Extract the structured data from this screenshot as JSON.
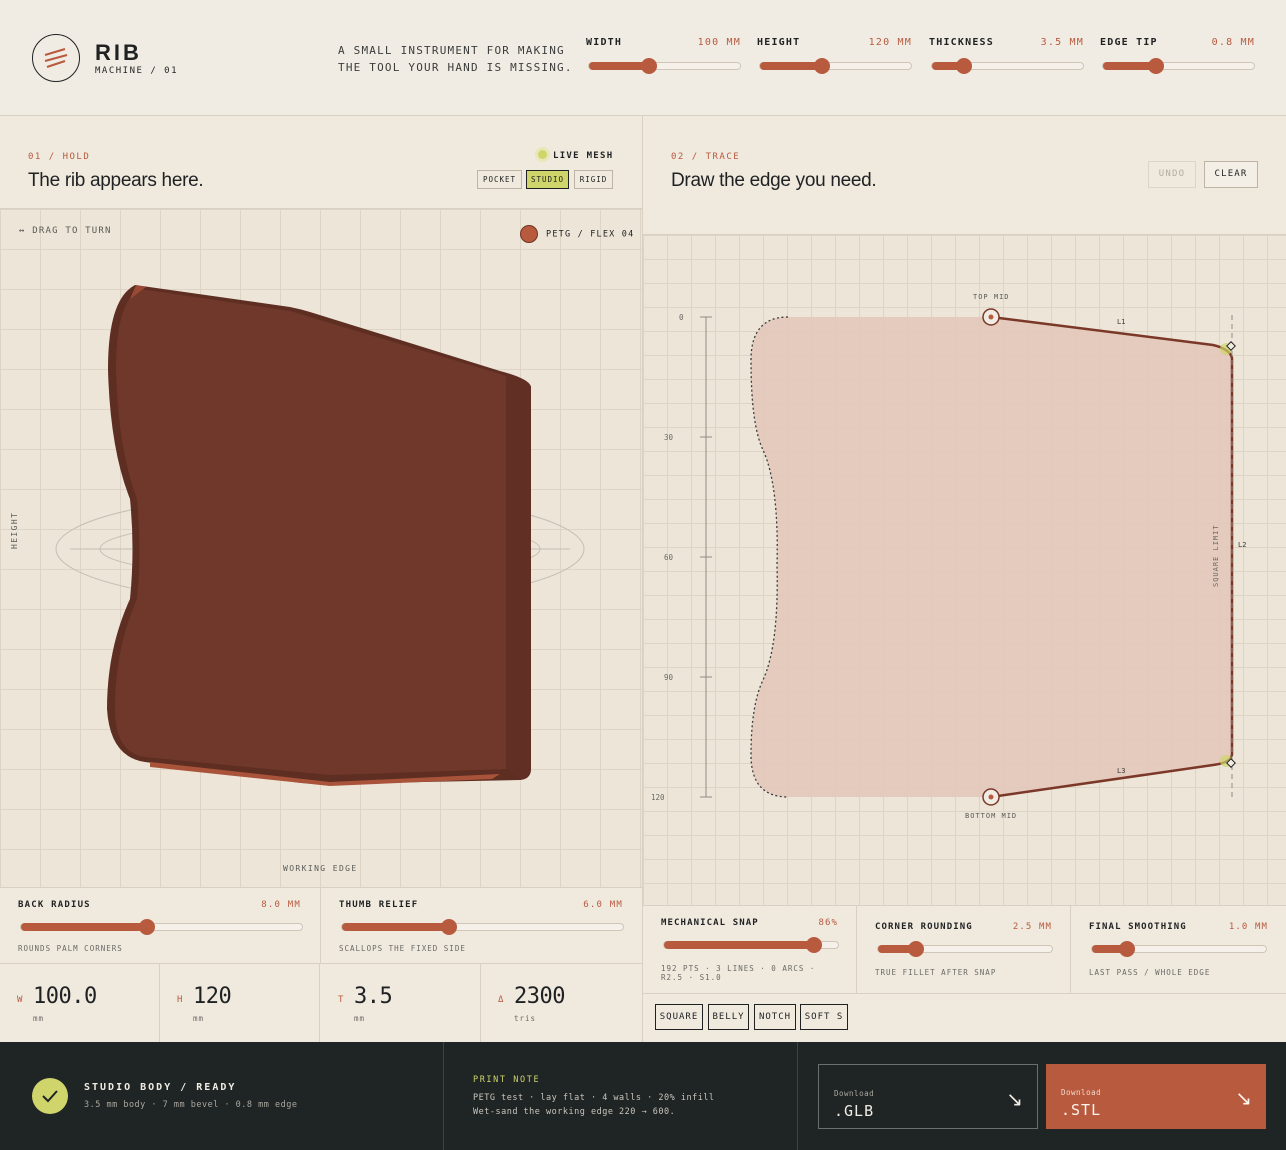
{
  "header": {
    "logo_title": "RIB",
    "logo_sub": "MACHINE / 01",
    "tagline_1": "A SMALL INSTRUMENT FOR MAKING",
    "tagline_2": "THE TOOL YOUR HAND IS MISSING.",
    "sliders": [
      {
        "label": "WIDTH",
        "value": "100 MM",
        "fill": 0.4
      },
      {
        "label": "HEIGHT",
        "value": "120 MM",
        "fill": 0.41
      },
      {
        "label": "THICKNESS",
        "value": "3.5 MM",
        "fill": 0.21
      },
      {
        "label": "EDGE TIP",
        "value": "0.8 MM",
        "fill": 0.35
      }
    ]
  },
  "hold": {
    "section": "01 / HOLD",
    "title": "The rib appears here.",
    "live": "LIVE MESH",
    "modes": [
      "POCKET",
      "STUDIO",
      "RIGID"
    ],
    "active_mode": "STUDIO",
    "drag_hint": "↔ DRAG TO TURN",
    "material": "PETG / FLEX 04",
    "height_label": "HEIGHT",
    "edge_label": "WORKING EDGE",
    "controls": [
      {
        "label": "BACK RADIUS",
        "value": "8.0 MM",
        "hint": "ROUNDS PALM CORNERS",
        "fill": 0.45
      },
      {
        "label": "THUMB RELIEF",
        "value": "6.0 MM",
        "hint": "SCALLOPS THE FIXED SIDE",
        "fill": 0.38
      }
    ],
    "stats": [
      {
        "key": "W",
        "value": "100.0",
        "unit": "mm"
      },
      {
        "key": "H",
        "value": "120",
        "unit": "mm"
      },
      {
        "key": "T",
        "value": "3.5",
        "unit": "mm"
      },
      {
        "key": "Δ",
        "value": "2300",
        "unit": "tris"
      }
    ]
  },
  "trace": {
    "section": "02 / TRACE",
    "title": "Draw the edge you need.",
    "undo": "UNDO",
    "clear": "CLEAR",
    "top_mid": "TOP MID",
    "bottom_mid": "BOTTOM MID",
    "l1": "L1",
    "l2": "L2",
    "l3": "L3",
    "square_limit": "SQUARE LIMIT",
    "ticks": [
      "0",
      "30",
      "60",
      "90",
      "120"
    ],
    "controls": [
      {
        "label": "MECHANICAL SNAP",
        "value": "86%",
        "hint": "192 PTS · 3 LINES · 0 ARCS · R2.5 · S1.0",
        "fill": 0.86
      },
      {
        "label": "CORNER ROUNDING",
        "value": "2.5 MM",
        "hint": "TRUE FILLET AFTER SNAP",
        "fill": 0.22
      },
      {
        "label": "FINAL SMOOTHING",
        "value": "1.0 MM",
        "hint": "LAST PASS / WHOLE EDGE",
        "fill": 0.2
      }
    ],
    "shapes": [
      "SQUARE",
      "BELLY",
      "NOTCH",
      "SOFT S"
    ]
  },
  "footer": {
    "ready_title": "STUDIO BODY / READY",
    "ready_sub": "3.5 mm body · 7 mm bevel · 0.8 mm edge",
    "note_title": "PRINT NOTE",
    "note_1": "PETG test · lay flat · 4 walls · 20% infill",
    "note_2": "Wet-sand the working edge 220 → 600.",
    "download_label": "Download",
    "glb": ".GLB",
    "stl": ".STL"
  },
  "colors": {
    "accent": "#b85a3e",
    "lime": "#cfd56a",
    "dark": "#1f2424",
    "paper": "#efe9de"
  }
}
